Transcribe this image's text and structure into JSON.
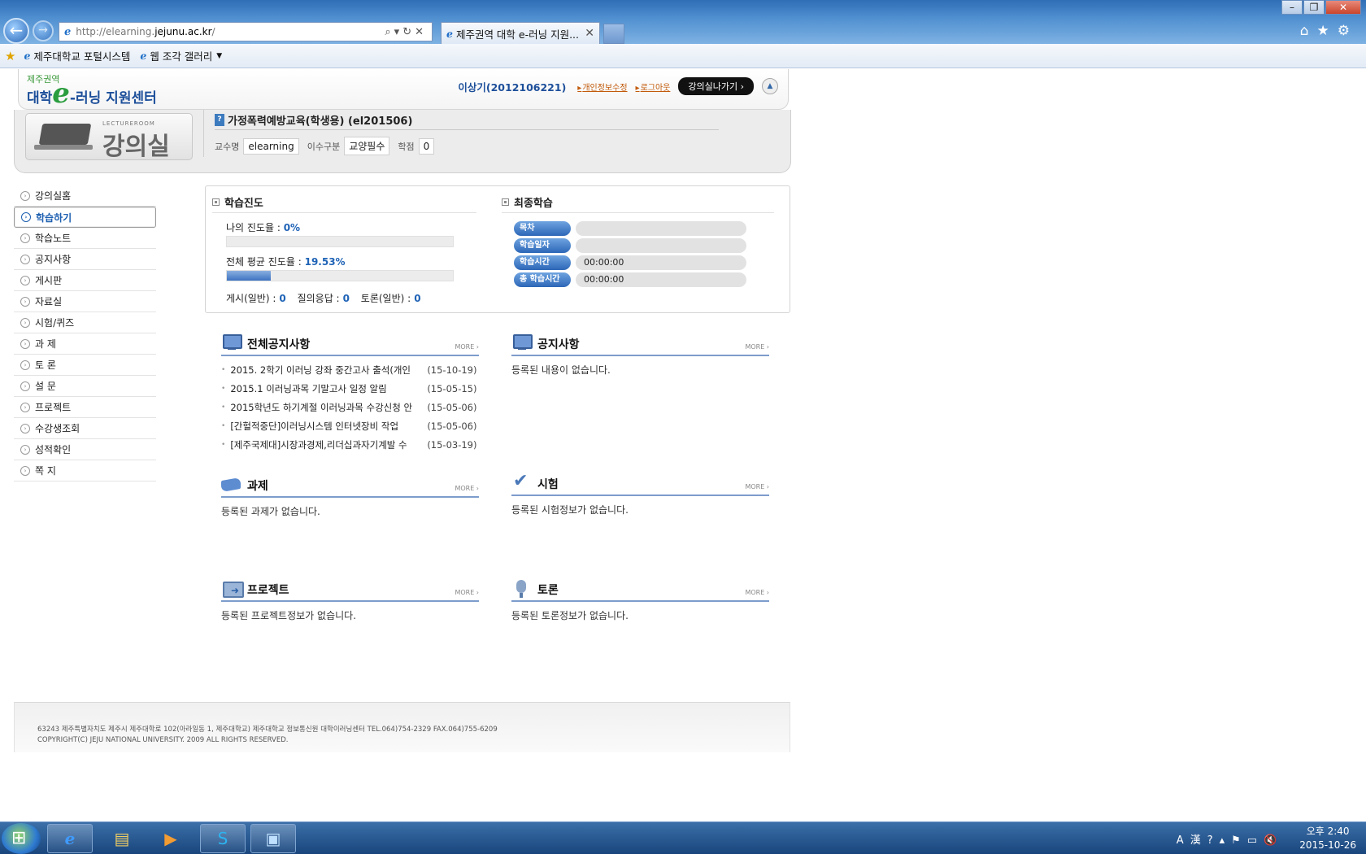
{
  "browser": {
    "back_label": "←",
    "forward_label": "→",
    "url_prefix": "http://elearning.",
    "url_host": "jejunu.ac.kr",
    "url_suffix": "/",
    "address_tools": "⌕▾↻✕",
    "tab_title": "제주권역 대학 e-러닝 지원...",
    "tab_close": "✕",
    "toolbar_right": "⌂★⚙",
    "window_controls": [
      "–",
      "❐",
      "✕"
    ],
    "favorites": [
      {
        "label": "제주대학교 포털시스템"
      },
      {
        "label": "웹 조각 갤러리",
        "has_dropdown": true
      }
    ]
  },
  "header": {
    "logo_small": "제주권역",
    "logo_pre": "대학",
    "logo_e": "e",
    "logo_post": "-러닝 지원센터",
    "user_name": "이상기(2012106221)",
    "links": [
      "개인정보수정",
      "로그아웃"
    ],
    "lecture_button": "강의실나가기 ›",
    "scroll_up": "▲"
  },
  "lecture_room": {
    "sub": "LECTUREROOM",
    "title": "강의실",
    "course_title": "가정폭력예방교육(학생용) (el201506)",
    "meta": [
      {
        "label": "교수명",
        "value": "elearning"
      },
      {
        "label": "이수구분",
        "value": "교양필수"
      },
      {
        "label": "학점",
        "value": "0"
      }
    ]
  },
  "sidebar": {
    "items": [
      {
        "label": "강의실홈",
        "active": false
      },
      {
        "label": "학습하기",
        "active": true
      },
      {
        "label": "학습노트",
        "active": false
      },
      {
        "label": "공지사항",
        "active": false
      },
      {
        "label": "게시판",
        "active": false
      },
      {
        "label": "자료실",
        "active": false
      },
      {
        "label": "시험/퀴즈",
        "active": false
      },
      {
        "label": "과 제",
        "active": false
      },
      {
        "label": "토 론",
        "active": false
      },
      {
        "label": "설 문",
        "active": false
      },
      {
        "label": "프로젝트",
        "active": false
      },
      {
        "label": "수강생조회",
        "active": false
      },
      {
        "label": "성적확인",
        "active": false
      },
      {
        "label": "쪽 지",
        "active": false
      }
    ]
  },
  "progress": {
    "heading": "학습진도",
    "my_label": "나의 진도율 : ",
    "my_value": "0%",
    "my_fraction": 0,
    "avg_label": "전체 평균 진도율 : ",
    "avg_value": "19.53%",
    "avg_fraction": 0.1953,
    "counts": [
      {
        "label": "게시(일반) :",
        "value": "0"
      },
      {
        "label": "질의응답 :",
        "value": "0"
      },
      {
        "label": "토론(일반) :",
        "value": "0"
      }
    ]
  },
  "last_study": {
    "heading": "최종학습",
    "rows": [
      {
        "label": "목차",
        "value": ""
      },
      {
        "label": "학습일자",
        "value": ""
      },
      {
        "label": "학습시간",
        "value": "00:00:00"
      },
      {
        "label": "총 학습시간",
        "value": "00:00:00"
      }
    ]
  },
  "boards": {
    "more": "MORE",
    "all_notice": {
      "title": "전체공지사항",
      "items": [
        {
          "title": "2015. 2학기 이러닝 강좌 중간고사 출석(개인",
          "date": "(15-10-19)"
        },
        {
          "title": "2015.1 이러닝과목 기말고사 일정 알림",
          "date": "(15-05-15)"
        },
        {
          "title": "2015학년도 하기계절 이러닝과목 수강신청 안",
          "date": "(15-05-06)"
        },
        {
          "title": "[간헐적중단]이러닝시스템 인터넷장비 작업",
          "date": "(15-05-06)"
        },
        {
          "title": "[제주국제대]시장과경제,리더십과자기계발 수",
          "date": "(15-03-19)"
        }
      ]
    },
    "notice": {
      "title": "공지사항",
      "empty": "등록된 내용이 없습니다."
    },
    "assignment": {
      "title": "과제",
      "empty": "등록된 과제가 없습니다."
    },
    "exam": {
      "title": "시험",
      "empty": "등록된 시험정보가 없습니다."
    },
    "project": {
      "title": "프로젝트",
      "empty": "등록된 프로젝트정보가 없습니다."
    },
    "discussion": {
      "title": "토론",
      "empty": "등록된 토론정보가 없습니다."
    }
  },
  "footer": {
    "address": "63243 제주특별자치도 제주시 제주대학로 102(아라일동 1, 제주대학교) 제주대학교 정보통신원 대학이러닝센터 TEL.064)754-2329 FAX.064)755-6209",
    "copyright": "COPYRIGHT(C) JEJU NATIONAL UNIVERSITY. 2009 ALL RIGHTS RESERVED."
  },
  "taskbar": {
    "apps": [
      "e",
      "▤",
      "▶",
      "S",
      "▣"
    ],
    "tray_icons": "A漢?▴⚑▭🔇",
    "time": "오후 2:40",
    "date": "2015-10-26"
  }
}
